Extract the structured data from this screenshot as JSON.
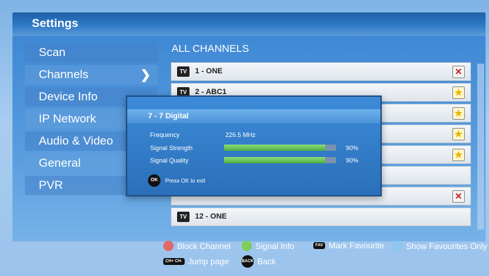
{
  "header": {
    "title": "Settings"
  },
  "sidebar": {
    "items": [
      {
        "label": "Scan"
      },
      {
        "label": "Channels",
        "selected": true
      },
      {
        "label": "Device Info"
      },
      {
        "label": "IP Network"
      },
      {
        "label": "Audio & Video"
      },
      {
        "label": "General"
      },
      {
        "label": "PVR"
      }
    ]
  },
  "channel_list": {
    "title": "ALL CHANNELS",
    "rows": [
      {
        "tv": "TV",
        "name": "1 - ONE",
        "status": "block"
      },
      {
        "tv": "TV",
        "name": "2 - ABC1",
        "status": "fav"
      },
      {
        "tv": "TV",
        "name": "12 - ONE",
        "status": ""
      }
    ]
  },
  "popup": {
    "title": "7 - 7 Digital",
    "frequency_label": "Frequency",
    "frequency_value": "226.5 MHz",
    "strength_label": "Signal Strength",
    "strength_value": "90%",
    "strength_level": 0.9,
    "quality_label": "Signal Quality",
    "quality_value": "90%",
    "quality_level": 0.9,
    "ok_key": "OK",
    "ok_hint": "Press OK to exit"
  },
  "legend": {
    "block_channel": "Block Channel",
    "signal_info": "Signal Info",
    "fav_key": "FAV",
    "mark_favourite": "Mark Favourite",
    "show_favourites": "Show Favourites Only",
    "jump_key": "CH+ CH-",
    "jump_page": "Jump page",
    "back_key": "BACK",
    "back": "Back"
  },
  "colors": {
    "red": "#e06a6a",
    "green": "#7fcd5a",
    "blue": "#8ec6f0",
    "fill": "#4cae3c"
  }
}
